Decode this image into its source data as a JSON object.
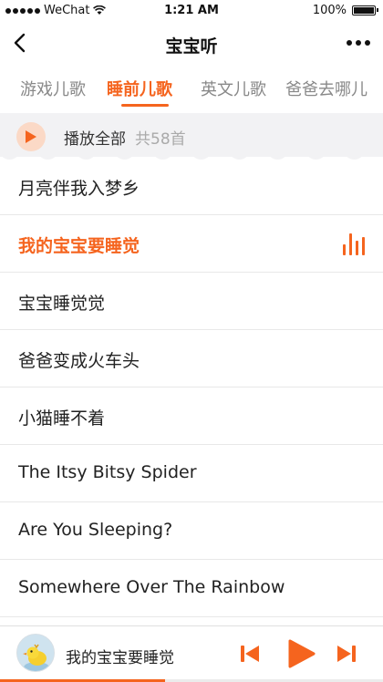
{
  "status": {
    "carrier": "WeChat",
    "time": "1:21 AM",
    "battery": "100%"
  },
  "nav": {
    "title": "宝宝听"
  },
  "tabs": [
    {
      "label": "游戏儿歌",
      "active": false
    },
    {
      "label": "睡前儿歌",
      "active": true
    },
    {
      "label": "英文儿歌",
      "active": false
    },
    {
      "label": "爸爸去哪儿",
      "active": false
    }
  ],
  "play_all": {
    "label": "播放全部",
    "count": "共58首"
  },
  "songs": [
    {
      "title": "月亮伴我入梦乡",
      "playing": false
    },
    {
      "title": "我的宝宝要睡觉",
      "playing": true
    },
    {
      "title": "宝宝睡觉觉",
      "playing": false
    },
    {
      "title": "爸爸变成火车头",
      "playing": false
    },
    {
      "title": "小猫睡不着",
      "playing": false
    },
    {
      "title": "The Itsy Bitsy Spider",
      "playing": false
    },
    {
      "title": "Are You Sleeping?",
      "playing": false
    },
    {
      "title": "Somewhere Over The Rainbow",
      "playing": false
    }
  ],
  "player": {
    "current_song": "我的宝宝要睡觉",
    "progress": 0.43
  },
  "colors": {
    "accent": "#f5641e",
    "accent_light": "#fbd9c6",
    "band": "#f2f2f4"
  },
  "icons": [
    "back-arrow-icon",
    "more-dots-icon",
    "play-icon",
    "equalizer-icon",
    "previous-track-icon",
    "next-track-icon"
  ]
}
